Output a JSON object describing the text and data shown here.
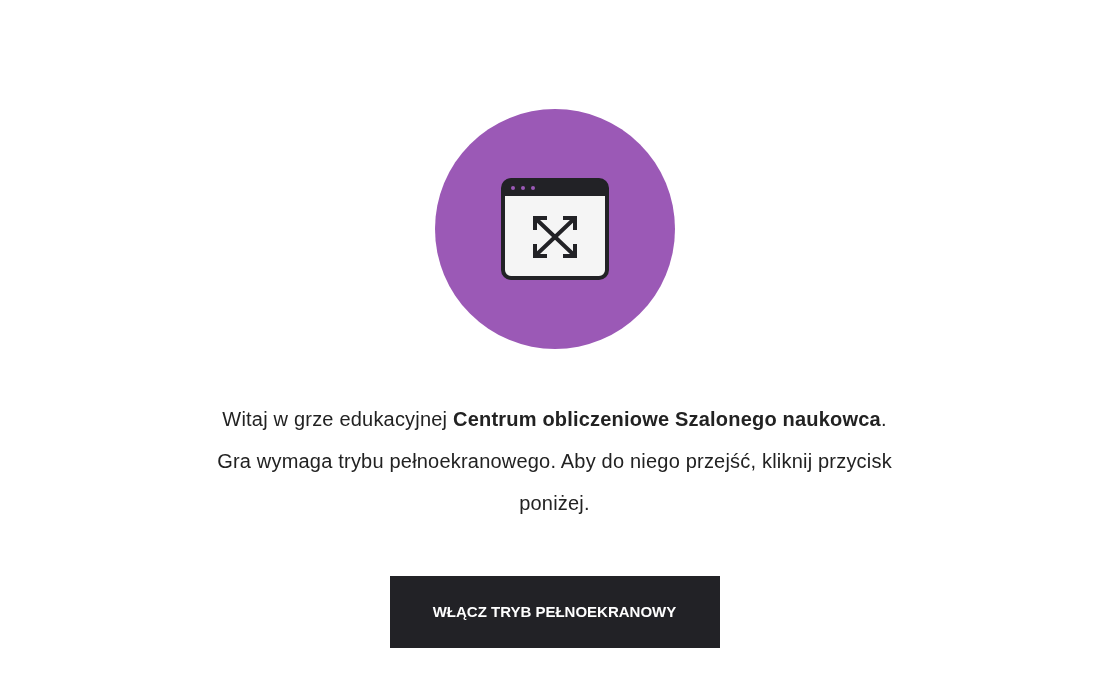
{
  "intro": {
    "text": "Witaj w grze edukacyjnej **Centrum obliczeniowe Szalonego naukowca**. Gra wymaga trybu pełnoekranowego. Aby do niego przejść, kliknij przycisk poniżej."
  },
  "button": {
    "label": "WŁĄCZ TRYB PEŁNOEKRANOWY"
  }
}
